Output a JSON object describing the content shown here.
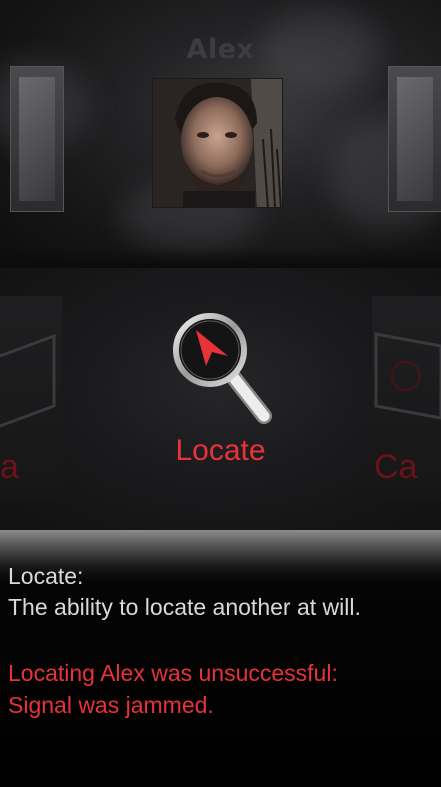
{
  "character": {
    "name": "Alex"
  },
  "ability": {
    "selected_label": "Locate",
    "left_ghost_label": "a",
    "right_ghost_label": "Ca",
    "icon": "magnifier-compass-icon"
  },
  "description": {
    "name_line": "Locate:",
    "text": "The ability to locate another at will.",
    "result_line": "Locating Alex was unsuccessful:",
    "reason_line": "Signal was jammed."
  },
  "colors": {
    "accent_red": "#e8323a",
    "text_light": "#d9d9d9"
  }
}
